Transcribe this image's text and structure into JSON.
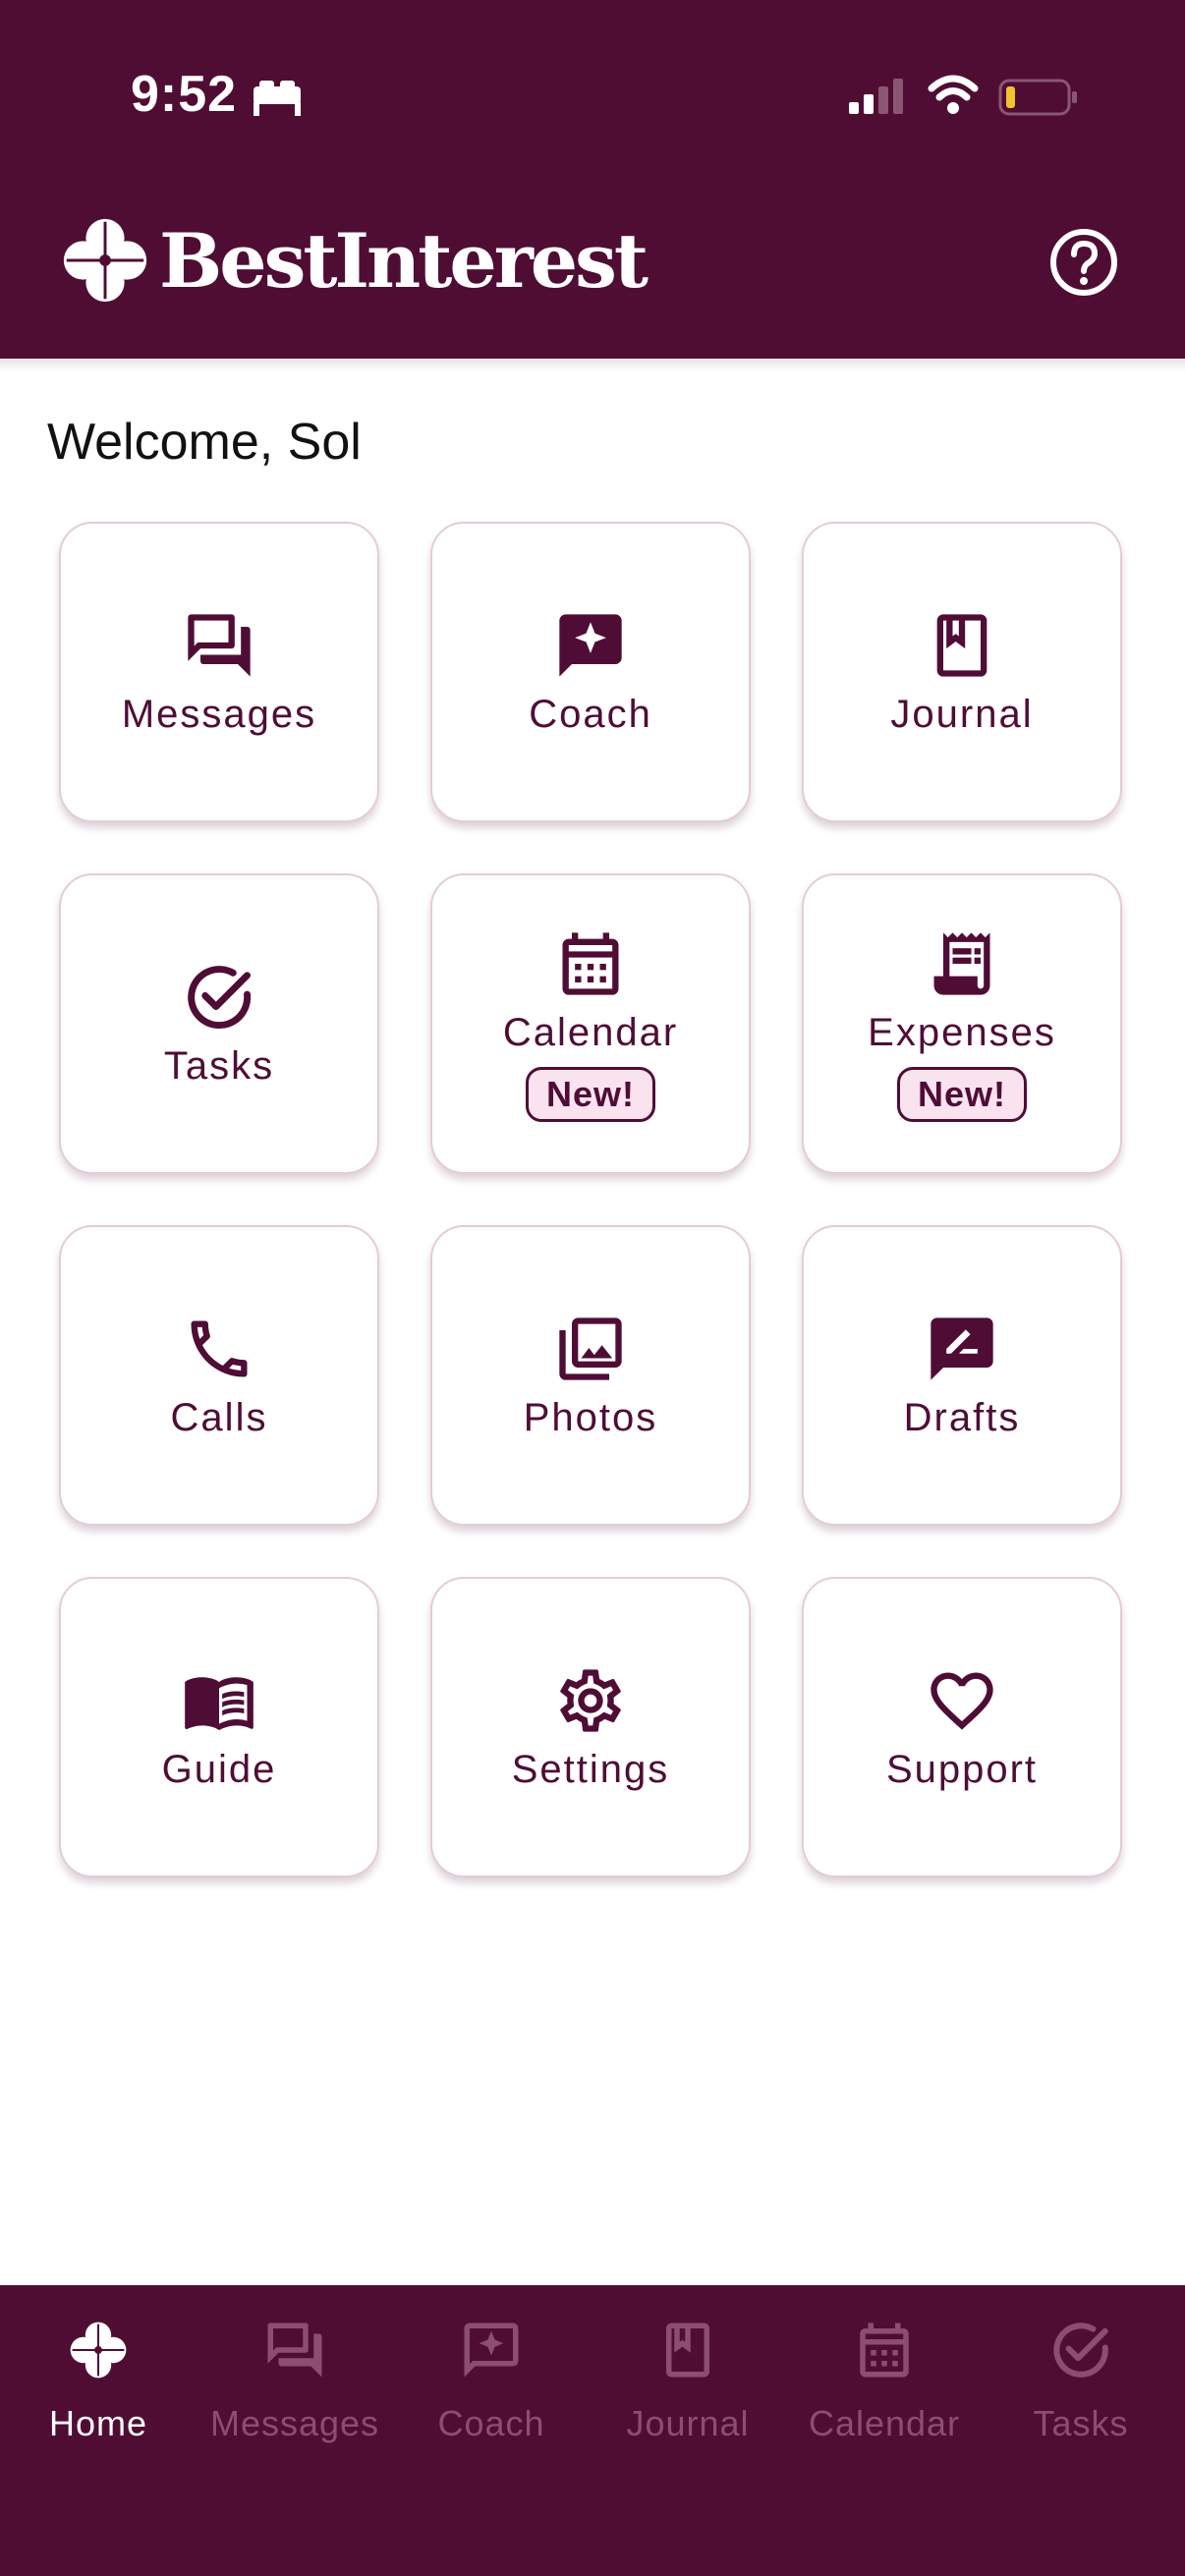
{
  "status_bar": {
    "time": "9:52",
    "icons": [
      "bed-icon",
      "signal-icon",
      "wifi-icon",
      "battery-icon"
    ]
  },
  "header": {
    "brand_name": "BestInterest",
    "logo_icon": "clover-logo",
    "help_icon": "help-circle-icon"
  },
  "welcome": {
    "text": "Welcome, Sol"
  },
  "tiles": [
    {
      "label": "Messages",
      "icon": "chat-bubbles-icon"
    },
    {
      "label": "Coach",
      "icon": "sparkle-chat-icon"
    },
    {
      "label": "Journal",
      "icon": "bookmark-book-icon"
    },
    {
      "label": "Tasks",
      "icon": "check-circle-icon"
    },
    {
      "label": "Calendar",
      "icon": "calendar-icon",
      "badge": "New!"
    },
    {
      "label": "Expenses",
      "icon": "receipt-icon",
      "badge": "New!"
    },
    {
      "label": "Calls",
      "icon": "phone-icon"
    },
    {
      "label": "Photos",
      "icon": "photo-library-icon"
    },
    {
      "label": "Drafts",
      "icon": "draft-icon"
    },
    {
      "label": "Guide",
      "icon": "open-book-icon"
    },
    {
      "label": "Settings",
      "icon": "gear-icon"
    },
    {
      "label": "Support",
      "icon": "heart-icon"
    }
  ],
  "nav": {
    "active": "Home",
    "items": [
      {
        "label": "Home",
        "icon": "clover-icon"
      },
      {
        "label": "Messages",
        "icon": "chat-bubbles-icon"
      },
      {
        "label": "Coach",
        "icon": "sparkle-chat-icon"
      },
      {
        "label": "Journal",
        "icon": "bookmark-book-icon"
      },
      {
        "label": "Calendar",
        "icon": "calendar-icon"
      },
      {
        "label": "Tasks",
        "icon": "check-circle-icon"
      }
    ]
  },
  "colors": {
    "brand": "#500d34",
    "tile_border": "#e3ccd8",
    "badge_bg": "#f8e3ee",
    "nav_inactive": "#8c4d72"
  }
}
